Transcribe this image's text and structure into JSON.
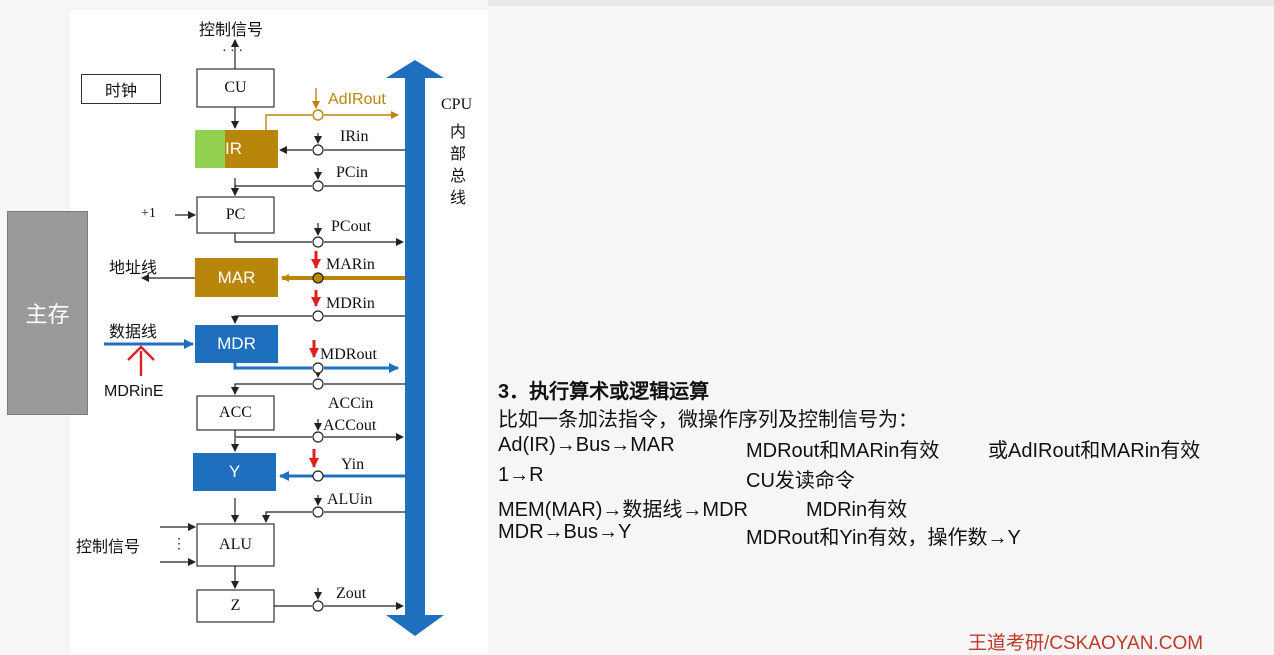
{
  "memory_label": "主存",
  "labels": {
    "control_signals_top": "控制信号",
    "clock": "时钟",
    "address_line": "地址线",
    "data_line": "数据线",
    "control_signals_left": "控制信号",
    "plus_one": "+1",
    "ellipsis": "· · ·",
    "bus_title_1": "CPU",
    "bus_title_2": "内",
    "bus_title_3": "部",
    "bus_title_4": "总",
    "bus_title_5": "线",
    "mdrine": "MDRinE"
  },
  "registers": {
    "cu": "CU",
    "ir": "IR",
    "pc": "PC",
    "mar": "MAR",
    "mdr": "MDR",
    "acc": "ACC",
    "y": "Y",
    "alu": "ALU",
    "z": "Z"
  },
  "signals": {
    "adirout": "AdIRout",
    "irin": "IRin",
    "pcin": "PCin",
    "pcout": "PCout",
    "marin": "MARin",
    "mdrin": "MDRin",
    "mdrout": "MDRout",
    "accin": "ACCin",
    "accout": "ACCout",
    "yin": "Yin",
    "aluin": "ALUin",
    "zout": "Zout"
  },
  "colors": {
    "gold": "#b8860b",
    "blue": "#1f6fbf",
    "red": "#e02020",
    "green": "#92d050"
  },
  "panel": {
    "heading": "3．执行算术或逻辑运算",
    "intro": "比如一条加法指令，微操作序列及控制信号为：",
    "rows": [
      {
        "op": "Ad(IR)→Bus→MAR",
        "signal": "MDRout和MARin有效",
        "alt": "或AdIRout和MARin有效"
      },
      {
        "op": "1→R",
        "signal": "CU发读命令",
        "alt": ""
      },
      {
        "op": "MEM(MAR)→数据线→MDR",
        "signal": "MDRin有效",
        "alt": ""
      },
      {
        "op": "MDR→Bus→Y",
        "signal": "MDRout和Yin有效，操作数→Y",
        "alt": ""
      }
    ]
  },
  "footer": "王道考研/CSKAOYAN.COM"
}
